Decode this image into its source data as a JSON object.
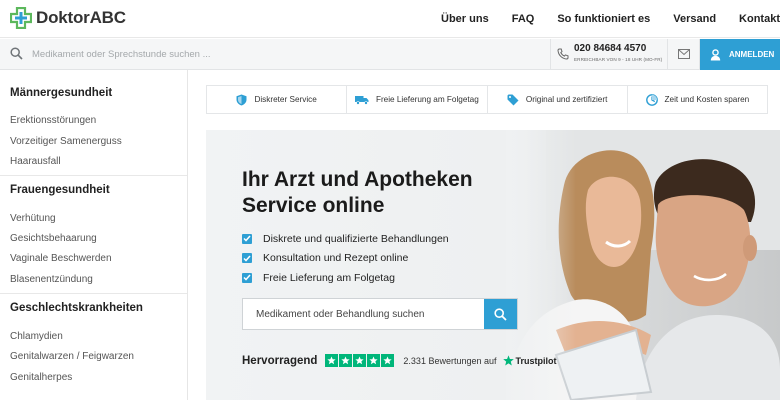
{
  "brand": {
    "name": "DoktorABC",
    "colors": {
      "accent": "#2e9fd4",
      "logo_green": "#5cb85c",
      "logo_blue": "#2e9fd4",
      "trustpilot_green": "#00b67a"
    }
  },
  "nav": {
    "items": [
      "Über uns",
      "FAQ",
      "So funktioniert es",
      "Versand",
      "Kontakt"
    ]
  },
  "topbar": {
    "search_placeholder": "Medikament oder Sprechstunde suchen ...",
    "phone_number": "020 84684 4570",
    "phone_hours": "ERREICHBAR VON 9 - 18 UHR (MO-FR)",
    "login_label": "ANMELDEN",
    "icons": [
      "search-icon",
      "phone-icon",
      "mail-icon",
      "user-icon"
    ]
  },
  "sidebar": {
    "categories": [
      {
        "title": "Männergesundheit",
        "items": [
          "Erektionsstörungen",
          "Vorzeitiger Samenerguss",
          "Haarausfall"
        ]
      },
      {
        "title": "Frauengesundheit",
        "items": [
          "Verhütung",
          "Gesichtsbehaarung",
          "Vaginale Beschwerden",
          "Blasenentzündung"
        ]
      },
      {
        "title": "Geschlechtskrankheiten",
        "items": [
          "Chlamydien",
          "Genitalwarzen / Feigwarzen",
          "Genitalherpes"
        ]
      }
    ]
  },
  "trustbar": {
    "items": [
      {
        "label": "Diskreter Service",
        "icon": "shield-icon"
      },
      {
        "label": "Freie Lieferung am Folgetag",
        "icon": "truck-icon"
      },
      {
        "label": "Original und zertifiziert",
        "icon": "tag-icon"
      },
      {
        "label": "Zeit und Kosten sparen",
        "icon": "clock-icon"
      }
    ]
  },
  "hero": {
    "title_line1": "Ihr Arzt und Apotheken",
    "title_line2": "Service online",
    "checks": [
      "Diskrete und qualifizierte Behandlungen",
      "Konsultation und Rezept online",
      "Freie Lieferung am Folgetag"
    ],
    "search_placeholder": "Medikament oder Behandlung suchen",
    "rating_word": "Hervorragend",
    "stars": 5,
    "review_count": "2.331 Bewertungen auf",
    "trustpilot": "Trustpilot"
  }
}
